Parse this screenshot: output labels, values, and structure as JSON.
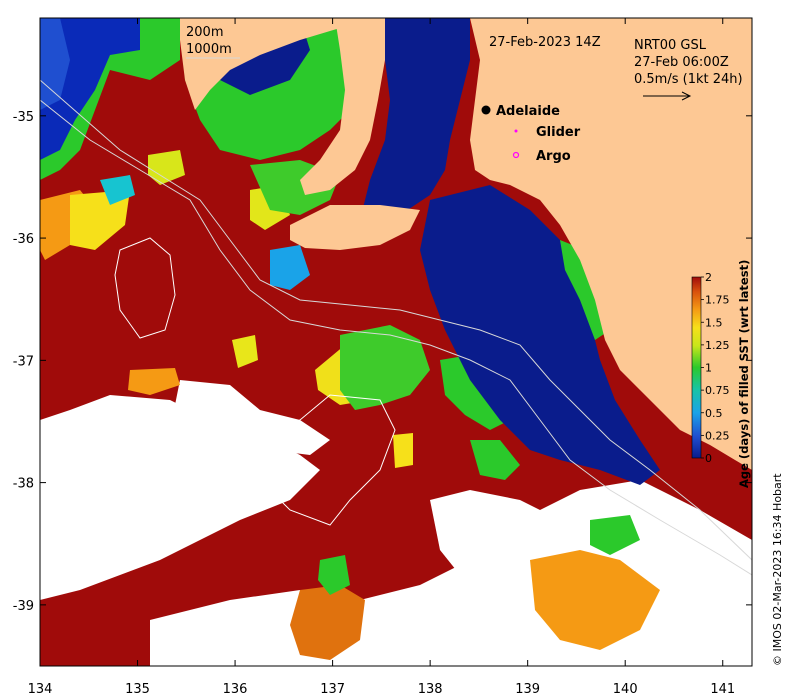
{
  "map": {
    "date_label": "27-Feb-2023 14Z",
    "isobaths": [
      "200m",
      "1000m"
    ],
    "current_product": "NRT00 GSL",
    "current_time": "27-Feb 06:00Z",
    "current_scale": "0.5m/s (1kt 24h)",
    "legend": {
      "city": "Adelaide",
      "glider": "Glider",
      "argo": "Argo"
    },
    "colors": {
      "land": "#fdc894",
      "water_young": "#0a1c8c",
      "water_old": "#a00b0a",
      "no_data": "#ffffff"
    }
  },
  "axes": {
    "x_ticks": [
      "134",
      "135",
      "136",
      "137",
      "138",
      "139",
      "140",
      "141"
    ],
    "y_ticks": [
      "-35",
      "-36",
      "-37",
      "-38",
      "-39"
    ],
    "x_range": [
      134,
      141.3
    ],
    "y_range": [
      -39.5,
      -34.2
    ]
  },
  "colorbar": {
    "title": "Age (days) of filled SST (wrt latest)",
    "ticks": [
      "2",
      "1.75",
      "1.5",
      "1.25",
      "1",
      "0.75",
      "0.5",
      "0.25",
      "0"
    ],
    "range": [
      0,
      2
    ]
  },
  "credit": "© IMOS 02-Mar-2023 16:34 Hobart"
}
